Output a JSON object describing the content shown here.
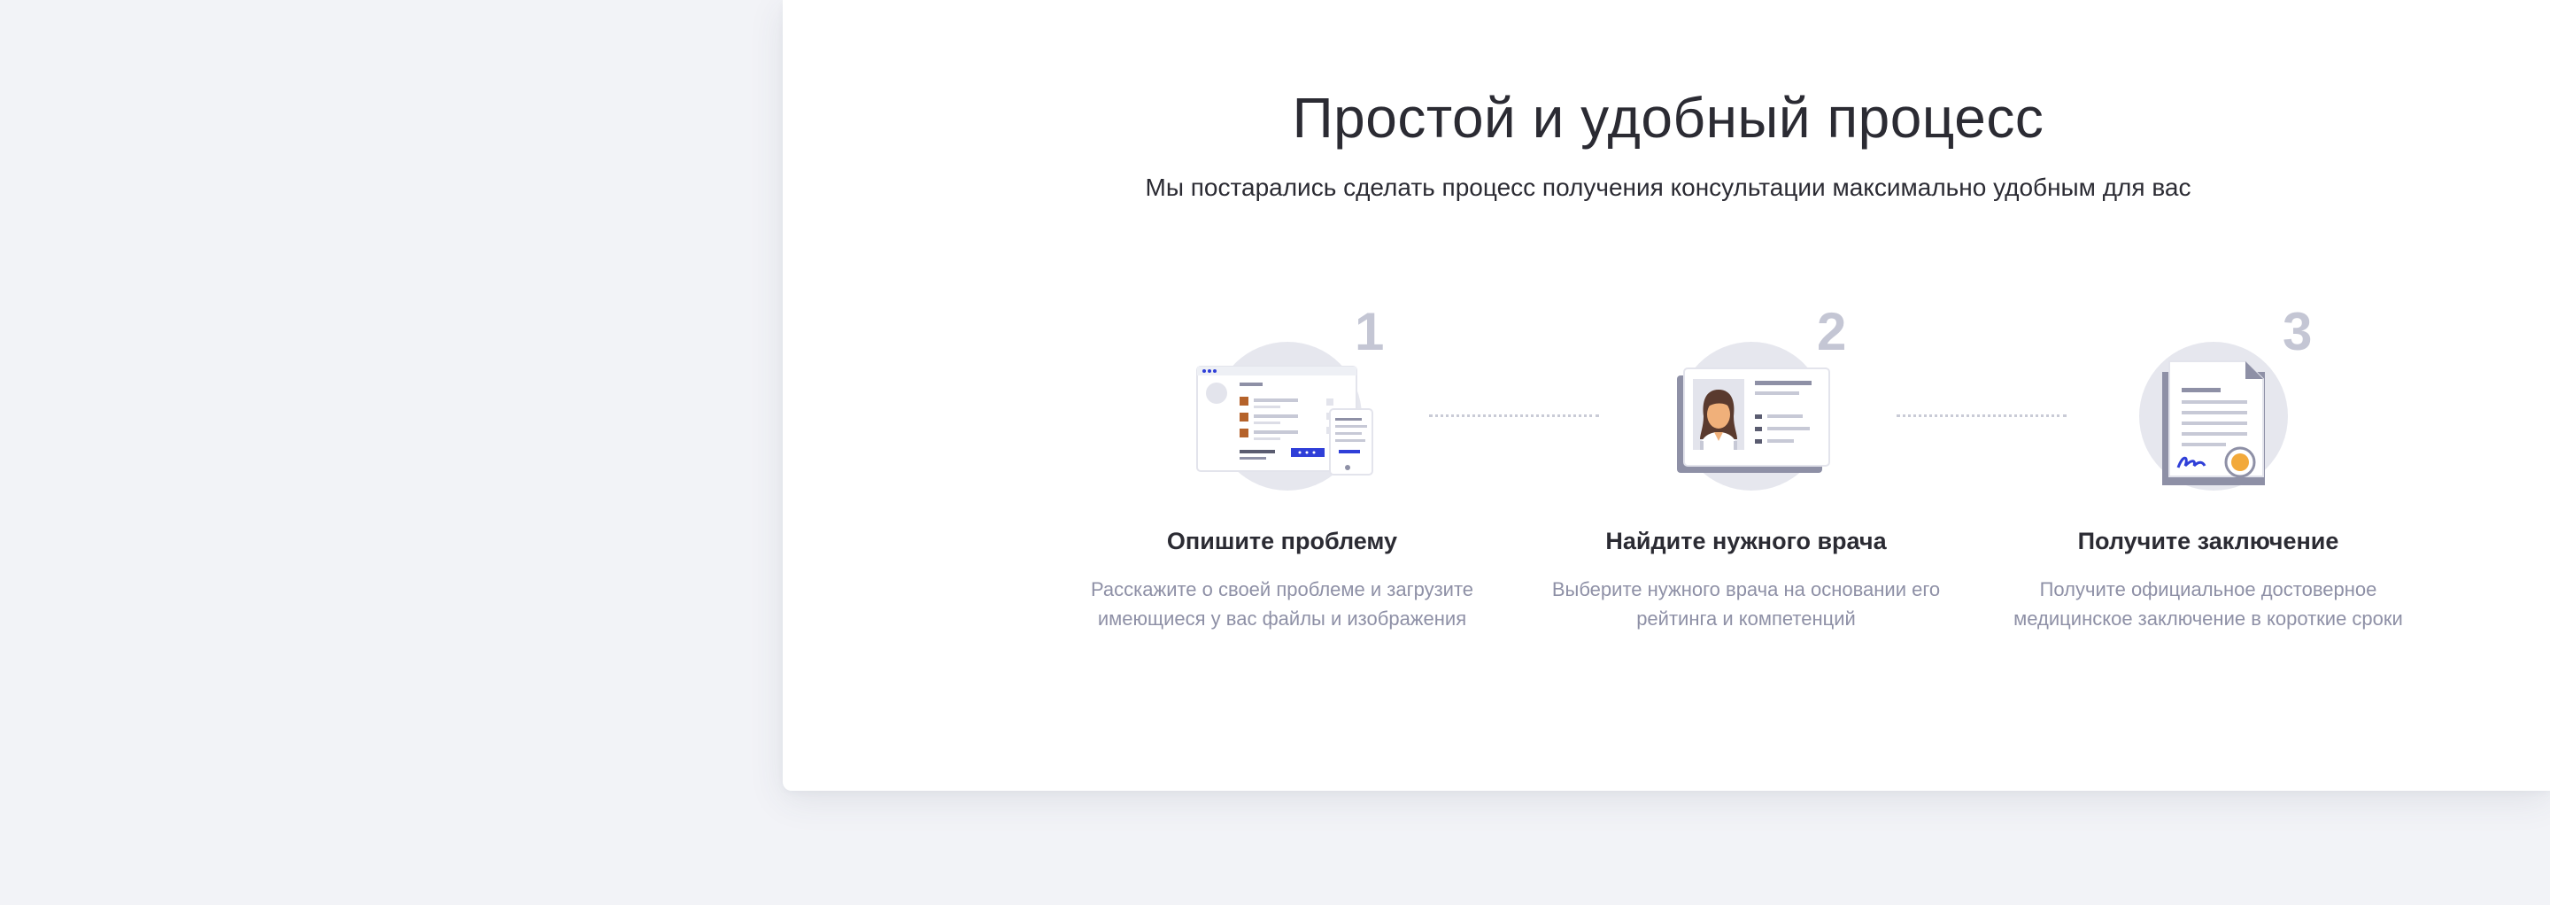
{
  "header": {
    "title": "Простой и удобный процесс",
    "subtitle": "Мы постарались сделать процесс получения консультации максимально удобным для вас"
  },
  "steps": [
    {
      "number": "1",
      "icon": "form-upload-icon",
      "title": "Опишите проблему",
      "description": "Расскажите о своей проблеме и загрузите имеющиеся у вас файлы и изображения"
    },
    {
      "number": "2",
      "icon": "doctor-profile-icon",
      "title": "Найдите нужного врача",
      "description": "Выберите нужного врача на основании его рейтинга и компетенций"
    },
    {
      "number": "3",
      "icon": "certificate-document-icon",
      "title": "Получите заключение",
      "description": "Получите официальное достоверное медицинское заключение в короткие сроки"
    }
  ],
  "colors": {
    "background": "#f2f3f7",
    "card": "#ffffff",
    "accent_blue": "#2f3fd8",
    "accent_orange": "#f2a93b",
    "muted_number": "#c4c6d4"
  }
}
